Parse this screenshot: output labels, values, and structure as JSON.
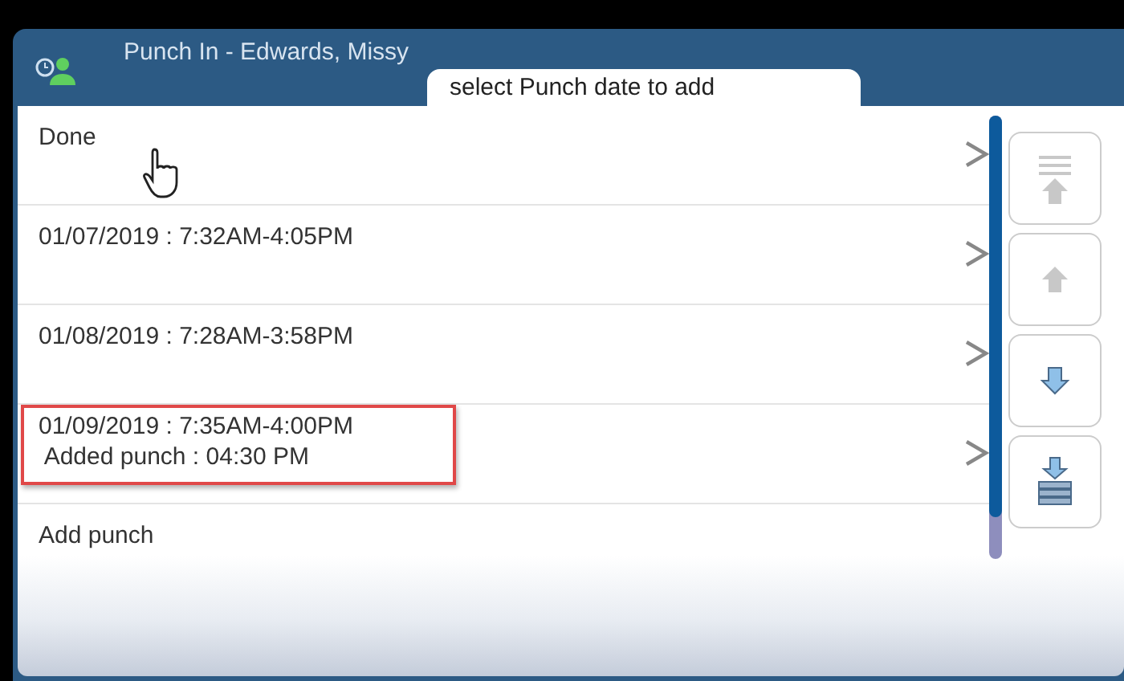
{
  "window": {
    "title": "Punch In - Edwards, Missy",
    "subtitle": "select Punch date to add"
  },
  "rows": [
    {
      "lines": [
        "Done"
      ],
      "highlighted": false,
      "chevron": true
    },
    {
      "lines": [
        "01/07/2019 : 7:32AM-4:05PM"
      ],
      "highlighted": false,
      "chevron": true
    },
    {
      "lines": [
        "01/08/2019 : 7:28AM-3:58PM"
      ],
      "highlighted": false,
      "chevron": true
    },
    {
      "lines": [
        "01/09/2019 : 7:35AM-4:00PM",
        " Added punch : 04:30 PM"
      ],
      "highlighted": true,
      "chevron": true
    },
    {
      "lines": [
        "Add punch"
      ],
      "highlighted": false,
      "chevron": false
    }
  ],
  "scroll_buttons": [
    {
      "kind": "top",
      "disabled": true
    },
    {
      "kind": "up",
      "disabled": true
    },
    {
      "kind": "down",
      "disabled": false
    },
    {
      "kind": "bottom",
      "disabled": false
    }
  ]
}
